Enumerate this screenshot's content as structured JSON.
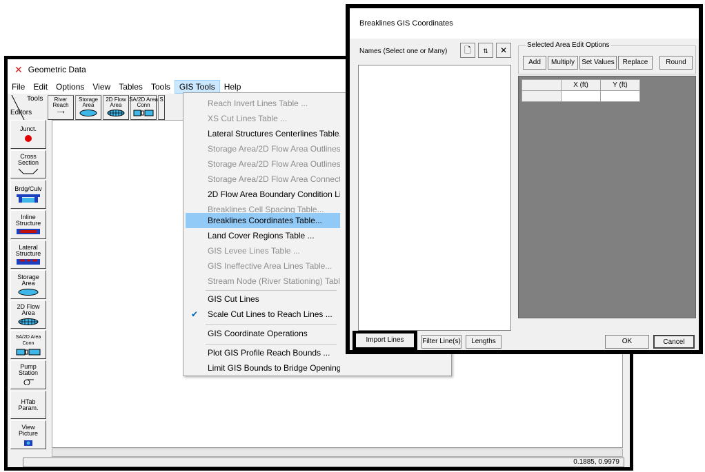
{
  "main_window": {
    "title": "Geometric Data",
    "menu": [
      "File",
      "Edit",
      "Options",
      "View",
      "Tables",
      "Tools",
      "GIS Tools",
      "Help"
    ],
    "active_menu": "GIS Tools",
    "toolbar": {
      "tools_label": "Tools",
      "editors_label": "Editors",
      "buttons": [
        "River\nReach",
        "Storage\nArea",
        "2D Flow\nArea",
        "SA/2D Area\nConn",
        "S"
      ]
    },
    "editors": [
      "Junct.",
      "Cross\nSection",
      "Brdg/Culv",
      "Inline\nStructure",
      "Lateral\nStructure",
      "Storage\nArea",
      "2D Flow\nArea",
      "SA/2D Area\nConn",
      "Pump\nStation",
      "HTab\nParam.",
      "View\nPicture"
    ],
    "status_coords": "0.1885, 0.9979"
  },
  "gis_menu": {
    "items": [
      {
        "label": "Reach Invert Lines Table ...",
        "enabled": false
      },
      {
        "label": "XS Cut Lines Table ...",
        "enabled": false
      },
      {
        "label": "Lateral Structures Centerlines Table...",
        "enabled": true
      },
      {
        "label": "Storage Area/2D Flow Area Outlines T",
        "enabled": false
      },
      {
        "label": "Storage Area/2D Flow Area Outlines F",
        "enabled": false
      },
      {
        "label": "Storage Area/2D Flow Area Connectic",
        "enabled": false
      },
      {
        "label": "2D Flow Area Boundary Condition Lin",
        "enabled": true
      },
      {
        "label": "Breaklines Cell Spacing Table...",
        "enabled": false
      },
      {
        "label": "Breaklines Coordinates Table...",
        "enabled": true,
        "highlighted": true
      },
      {
        "label": "Land Cover Regions Table ...",
        "enabled": true
      },
      {
        "label": "GIS Levee Lines Table ...",
        "enabled": false
      },
      {
        "label": "GIS Ineffective Area Lines Table...",
        "enabled": false
      },
      {
        "label": "Stream Node (River Stationing) Table",
        "enabled": false
      },
      {
        "label": "GIS Cut Lines",
        "enabled": true
      },
      {
        "label": "Scale Cut Lines to Reach Lines ...",
        "enabled": true,
        "checked": true
      },
      {
        "label": "GIS Coordinate Operations",
        "enabled": true
      },
      {
        "label": "Plot GIS Profile Reach Bounds ...",
        "enabled": true
      },
      {
        "label": "Limit GIS Bounds to Bridge Openings",
        "enabled": true
      }
    ]
  },
  "breaklines_dialog": {
    "title": "Breaklines GIS Coordinates",
    "names_label": "Names (Select one or Many)",
    "selected_area_title": "Selected Area Edit Options",
    "area_buttons": [
      "Add",
      "Multiply",
      "Set Values",
      "Replace",
      "Round"
    ],
    "grid_headers": [
      "X (ft)",
      "Y (ft)"
    ],
    "bottom_buttons": {
      "import": "Import Lines",
      "filter": "Filter Line(s)",
      "lengths": "Lengths",
      "ok": "OK",
      "cancel": "Cancel"
    }
  }
}
